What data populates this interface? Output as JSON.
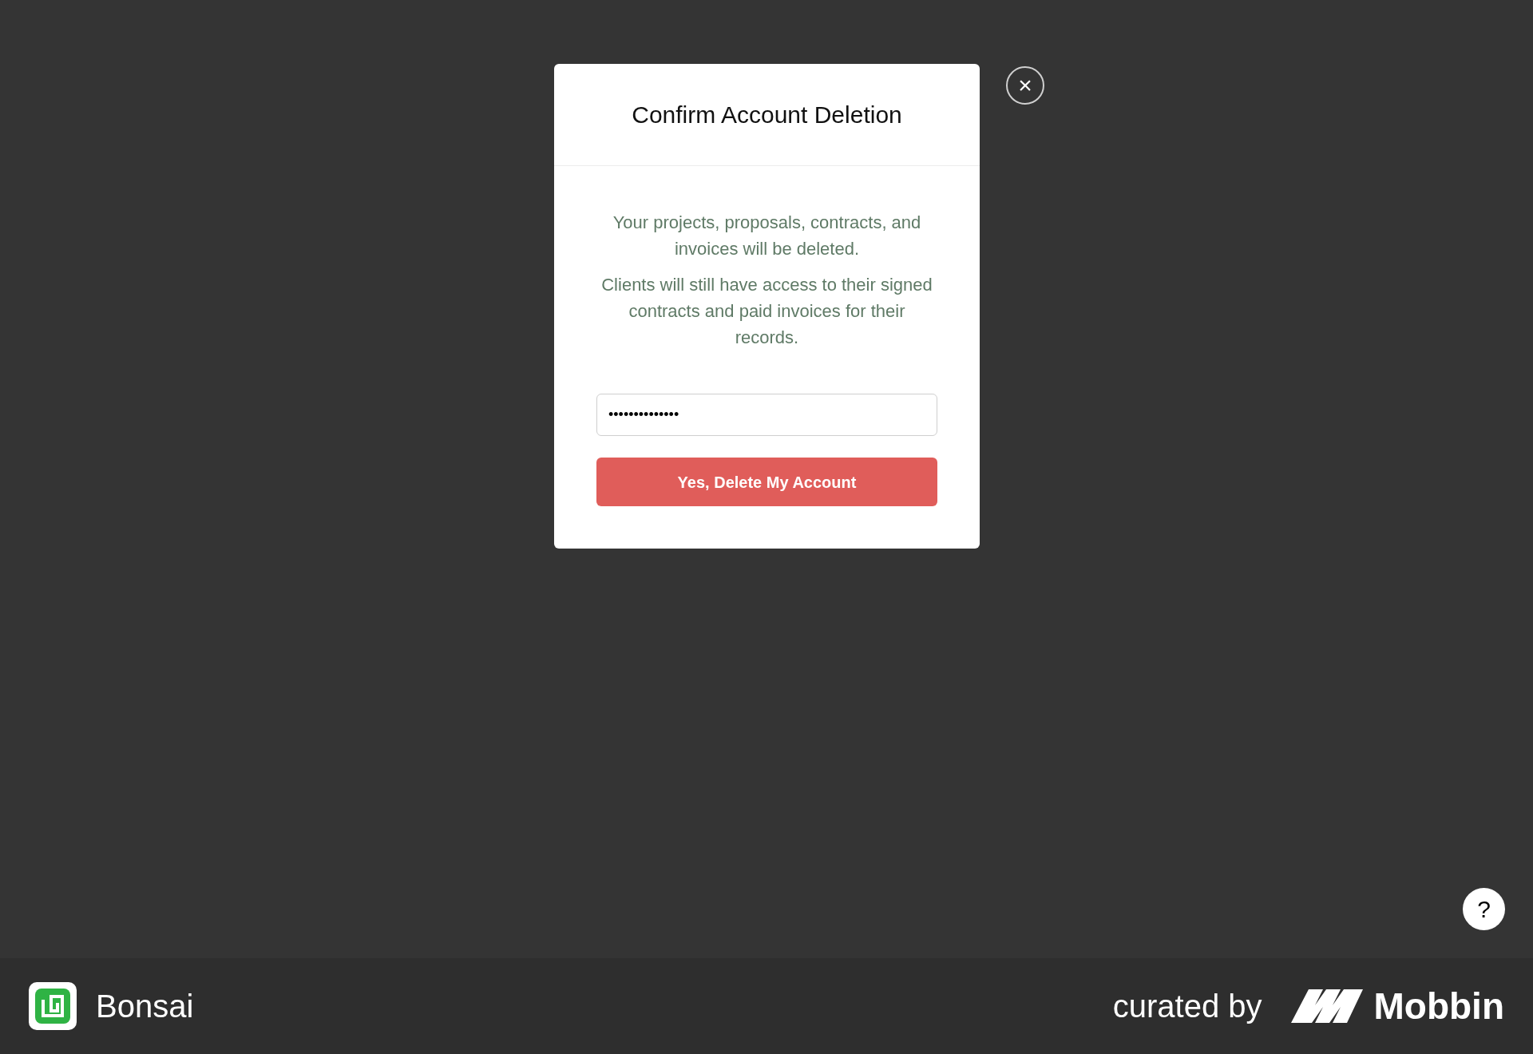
{
  "dialog": {
    "title": "Confirm Account Deletion",
    "paragraphs": [
      "Your projects, proposals, contracts, and invoices will be deleted.",
      "Clients will still have access to their signed contracts and paid invoices for their records."
    ],
    "password_field": {
      "value": "••••••••••••••"
    },
    "confirm_button": "Yes, Delete My Account",
    "close_button": "×"
  },
  "help_button": "?",
  "footer": {
    "app_name": "Bonsai",
    "curated_by": "curated by",
    "brand": "Mobbin"
  }
}
